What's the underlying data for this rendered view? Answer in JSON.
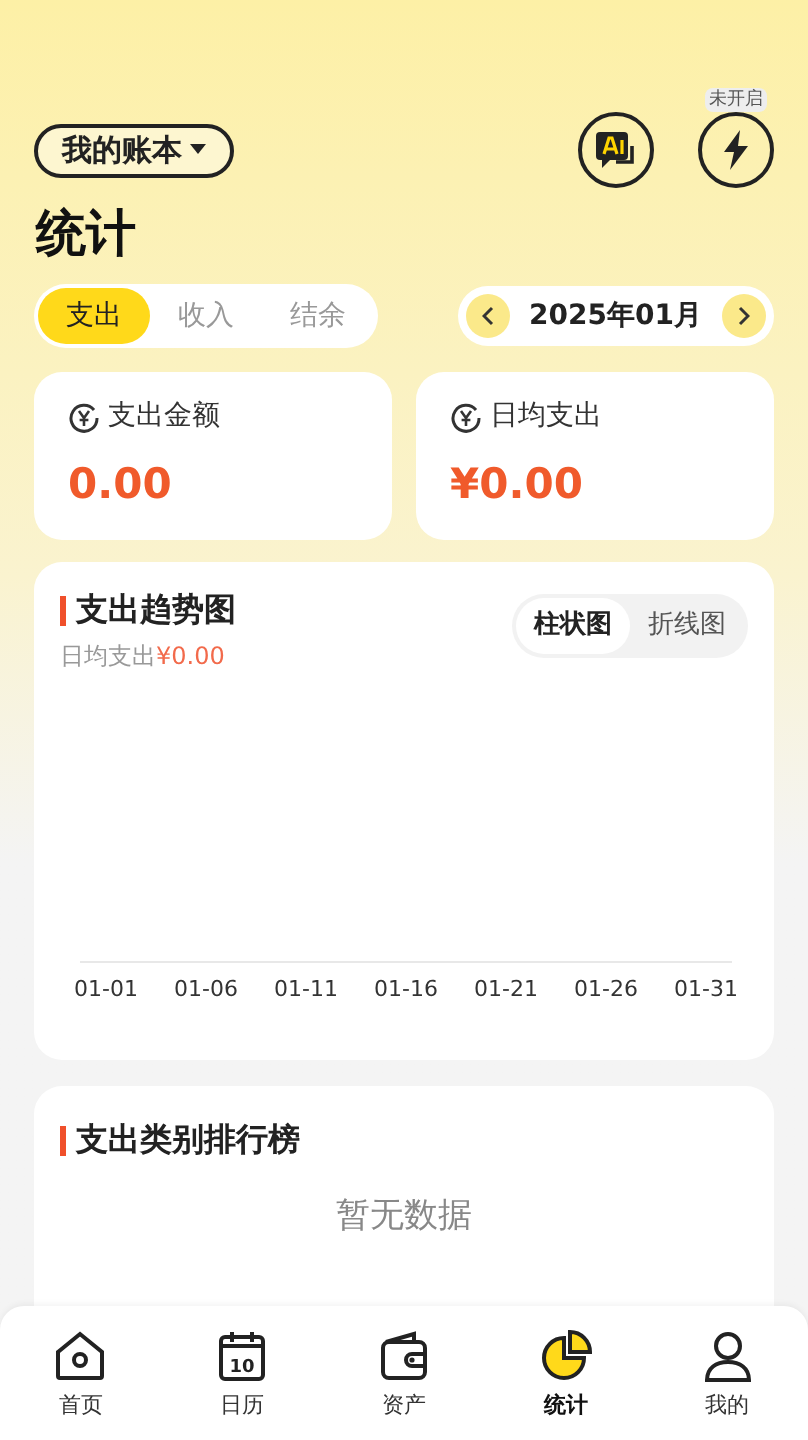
{
  "header": {
    "ledger": "我的账本",
    "flash": {
      "badge": "未开启"
    }
  },
  "title": "统计",
  "type_tabs": [
    {
      "label": "支出",
      "selected": true
    },
    {
      "label": "收入",
      "selected": false
    },
    {
      "label": "结余",
      "selected": false
    }
  ],
  "month": {
    "label": "2025年01月"
  },
  "summary": [
    {
      "label": "支出金额",
      "value": "0.00"
    },
    {
      "label": "日均支出",
      "value": "¥0.00"
    }
  ],
  "trend": {
    "title": "支出趋势图",
    "subtitle_label": "日均支出",
    "subtitle_value": "¥0.00",
    "modes": [
      {
        "label": "柱状图",
        "selected": true
      },
      {
        "label": "折线图",
        "selected": false
      }
    ],
    "axis_labels": [
      "01-01",
      "01-06",
      "01-11",
      "01-16",
      "01-21",
      "01-26",
      "01-31"
    ]
  },
  "ranking": {
    "title": "支出类别排行榜",
    "empty": "暂无数据"
  },
  "nav": [
    {
      "label": "首页",
      "kind": "home",
      "selected": false
    },
    {
      "label": "日历",
      "kind": "calendar",
      "icon_text": "10",
      "selected": false
    },
    {
      "label": "资产",
      "kind": "wallet",
      "selected": false
    },
    {
      "label": "统计",
      "kind": "stats",
      "selected": true
    },
    {
      "label": "我的",
      "kind": "profile",
      "selected": false
    }
  ]
}
